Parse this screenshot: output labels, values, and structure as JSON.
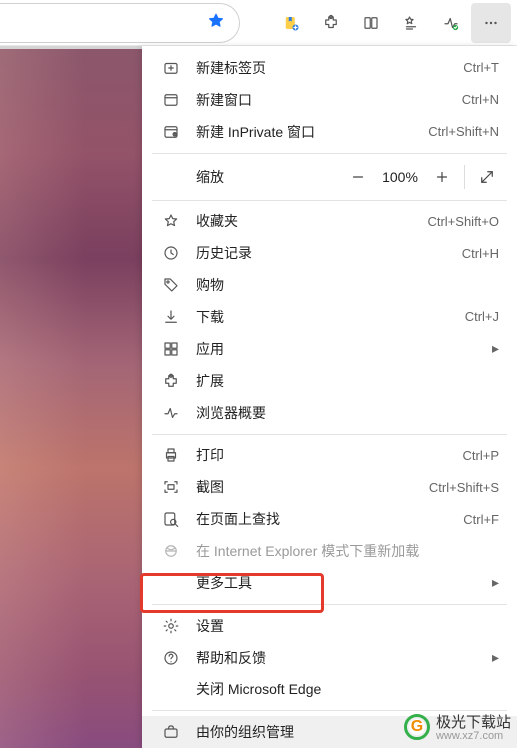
{
  "toolbar": {
    "star_filled": true,
    "icons": [
      "collections",
      "extension",
      "split",
      "favorites-list",
      "performance",
      "more"
    ]
  },
  "menu": {
    "new_tab": {
      "label": "新建标签页",
      "shortcut": "Ctrl+T"
    },
    "new_window": {
      "label": "新建窗口",
      "shortcut": "Ctrl+N"
    },
    "new_inprivate": {
      "label": "新建 InPrivate 窗口",
      "shortcut": "Ctrl+Shift+N"
    },
    "zoom": {
      "label": "缩放",
      "value": "100%"
    },
    "favorites": {
      "label": "收藏夹",
      "shortcut": "Ctrl+Shift+O"
    },
    "history": {
      "label": "历史记录",
      "shortcut": "Ctrl+H"
    },
    "shopping": {
      "label": "购物"
    },
    "downloads": {
      "label": "下载",
      "shortcut": "Ctrl+J"
    },
    "apps": {
      "label": "应用"
    },
    "extensions": {
      "label": "扩展"
    },
    "browser_essentials": {
      "label": "浏览器概要"
    },
    "print": {
      "label": "打印",
      "shortcut": "Ctrl+P"
    },
    "screenshot": {
      "label": "截图",
      "shortcut": "Ctrl+Shift+S"
    },
    "find": {
      "label": "在页面上查找",
      "shortcut": "Ctrl+F"
    },
    "ie_reload": {
      "label": "在 Internet Explorer 模式下重新加载"
    },
    "more_tools": {
      "label": "更多工具"
    },
    "settings": {
      "label": "设置"
    },
    "help": {
      "label": "帮助和反馈"
    },
    "close_edge": {
      "label": "关闭 Microsoft Edge"
    },
    "managed": {
      "label": "由你的组织管理"
    }
  },
  "watermark": {
    "brand": "极光下载站",
    "url": "www.xz7.com"
  }
}
